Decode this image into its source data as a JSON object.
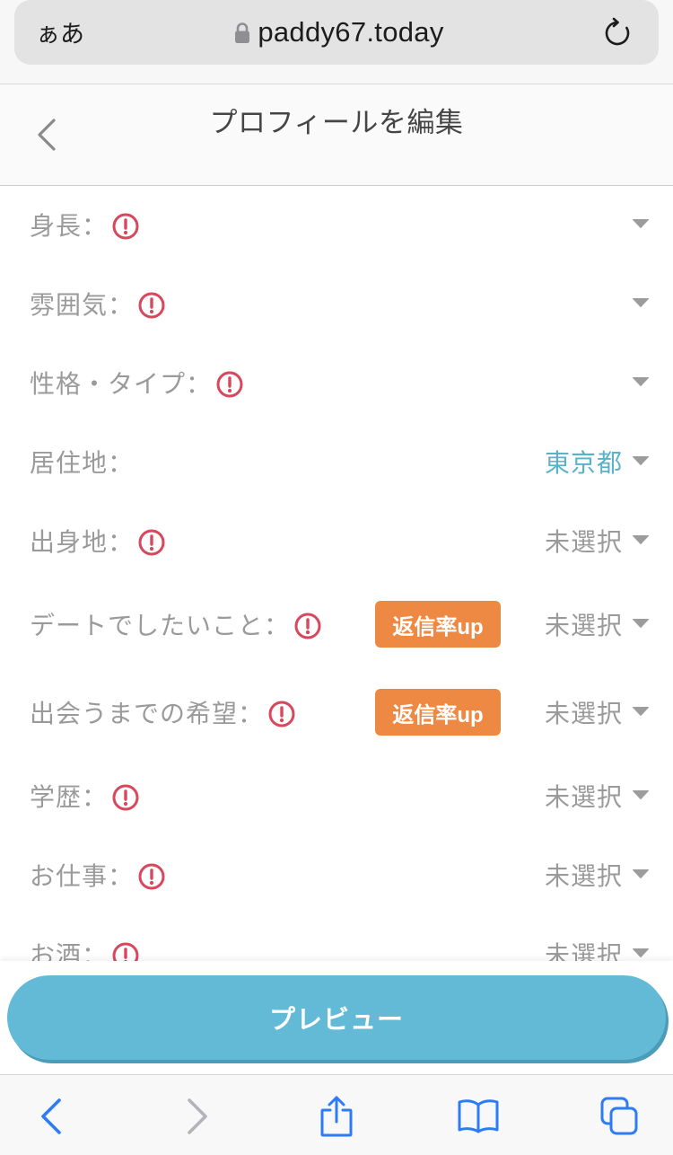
{
  "browser": {
    "text_size_label": "ぁあ",
    "url": "paddy67.today",
    "lock_icon": "lock-icon",
    "reload_icon": "reload-icon"
  },
  "header": {
    "back_icon": "chevron-left-icon",
    "title": "プロフィールを編集"
  },
  "fields": [
    {
      "label": "身長：",
      "warning": true
    },
    {
      "label": "雰囲気：",
      "warning": true
    },
    {
      "label": "性格・タイプ：",
      "warning": true
    },
    {
      "label": "居住地：",
      "warning": false,
      "value": "東京都",
      "selected": true
    },
    {
      "label": "出身地：",
      "warning": true,
      "value": "未選択",
      "selected": false
    },
    {
      "label": "デートでしたいこと：",
      "warning": true,
      "badge": "返信率up",
      "value": "未選択",
      "selected": false
    },
    {
      "label": "出会うまでの希望：",
      "warning": true,
      "badge": "返信率up",
      "value": "未選択",
      "selected": false
    },
    {
      "label": "学歴：",
      "warning": true,
      "value": "未選択",
      "selected": false
    },
    {
      "label": "お仕事：",
      "warning": true,
      "value": "未選択",
      "selected": false
    },
    {
      "label": "お酒：",
      "warning": true,
      "value": "未選択",
      "selected": false
    }
  ],
  "field_icons": {
    "warning": "warning-icon",
    "dropdown": "dropdown-arrow-icon"
  },
  "preview_button": {
    "label": "プレビュー"
  },
  "toolbar": {
    "items": [
      {
        "icon": "back-icon",
        "enabled": true
      },
      {
        "icon": "forward-icon",
        "enabled": false
      },
      {
        "icon": "share-icon",
        "enabled": true
      },
      {
        "icon": "bookmarks-icon",
        "enabled": true
      },
      {
        "icon": "tabs-icon",
        "enabled": true
      }
    ]
  },
  "colors": {
    "label_text": "#9a9a9a",
    "warning": "#d8475b",
    "selected_value": "#58b3c9",
    "placeholder_value": "#9a9a9a",
    "badge": "#ee8944",
    "preview_button": "#62bad6",
    "toolbar_active": "#2d7cf6",
    "toolbar_disabled": "#b4b4b8"
  }
}
